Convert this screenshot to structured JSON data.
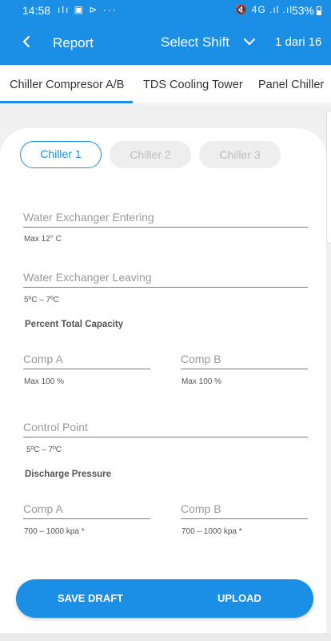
{
  "status_bar": {
    "time": "14:58",
    "left_icons": "ılı ▣ ⊳ ···",
    "right_icons": "🔇 4G .ıl .ıl",
    "battery": "53%"
  },
  "app_bar": {
    "title": "Report",
    "shift_select": "Select Shift",
    "pager": "1 dari 16"
  },
  "tabs": [
    {
      "label": "Chiller Compresor A/B",
      "active": true
    },
    {
      "label": "TDS Cooling Tower",
      "active": false
    },
    {
      "label": "Panel Chiller",
      "active": false
    }
  ],
  "chillers": [
    {
      "label": "Chiller 1",
      "active": true
    },
    {
      "label": "Chiller 2",
      "active": false
    },
    {
      "label": "Chiller 3",
      "active": false
    }
  ],
  "form": {
    "water_entering": {
      "placeholder": "Water Exchanger Entering",
      "value": "",
      "hint": "Max 12° C"
    },
    "water_leaving": {
      "placeholder": "Water Exchanger Leaving",
      "value": "",
      "hint": "5ºC – 7ºC"
    },
    "percent_total_capacity": {
      "title": "Percent Total Capacity",
      "comp_a": {
        "placeholder": "Comp A",
        "value": "",
        "hint": "Max 100 %"
      },
      "comp_b": {
        "placeholder": "Comp B",
        "value": "",
        "hint": "Max 100 %"
      }
    },
    "control_point": {
      "placeholder": "Control Point",
      "value": "",
      "hint": "5ºC – 7ºC"
    },
    "discharge_pressure": {
      "title": "Discharge Pressure",
      "comp_a": {
        "placeholder": "Comp A",
        "value": "",
        "hint": "700 – 1000  kpa *"
      },
      "comp_b": {
        "placeholder": "Comp B",
        "value": "",
        "hint": "700 – 1000  kpa *"
      }
    }
  },
  "actions": {
    "save_draft": "SAVE DRAFT",
    "upload": "UPLOAD"
  },
  "colors": {
    "primary": "#1b8fe6",
    "inactive_pill": "#eeeeee",
    "background": "#f0f0f0"
  }
}
